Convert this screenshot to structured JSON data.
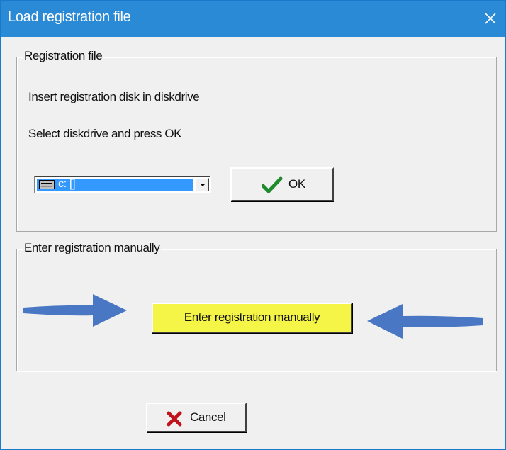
{
  "window": {
    "title": "Load registration file",
    "close_icon": "close-icon"
  },
  "registration_group": {
    "legend": "Registration file",
    "instruction_1": "Insert registration disk in diskdrive",
    "instruction_2": "Select diskdrive and press OK",
    "drive_select": {
      "selected": "c: []",
      "icon": "drive-icon"
    },
    "ok_button": {
      "label": "OK",
      "icon": "checkmark-icon"
    }
  },
  "manual_group": {
    "legend": "Enter registration manually",
    "button_label": "Enter registration manually"
  },
  "cancel_button": {
    "label": "Cancel",
    "icon": "red-x-icon"
  },
  "colors": {
    "titlebar": "#2b8ad6",
    "highlight_button": "#f5f547",
    "arrow": "#4a77c4",
    "selection": "#3399ff"
  }
}
